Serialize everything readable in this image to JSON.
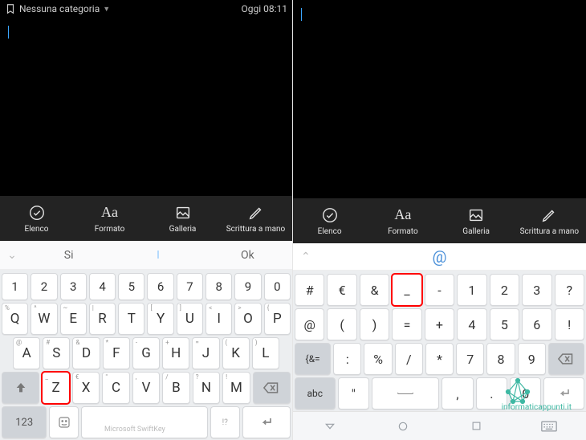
{
  "left": {
    "status": {
      "category_label": "Nessuna categoria",
      "time": "Oggi 08:11"
    },
    "toolbar": {
      "elenco": "Elenco",
      "formato": "Formato",
      "galleria": "Galleria",
      "scrittura": "Scrittura a mano"
    },
    "suggestions": {
      "left": "Si",
      "center": "I",
      "right": "Ok"
    },
    "keys": {
      "row_num": [
        "1",
        "2",
        "3",
        "4",
        "5",
        "6",
        "7",
        "8",
        "9",
        "0"
      ],
      "row_q": [
        "Q",
        "W",
        "E",
        "R",
        "T",
        "Y",
        "U",
        "I",
        "O",
        "P"
      ],
      "row_q_hints": [
        "%",
        "^",
        "~",
        "|",
        "",
        "[",
        "]",
        "<",
        ">",
        "{"
      ],
      "row_a": [
        "A",
        "S",
        "D",
        "F",
        "G",
        "H",
        "J",
        "K",
        "L"
      ],
      "row_a_hints": [
        "@",
        "#",
        "&",
        "*",
        "-",
        "+",
        "=",
        "(",
        ")"
      ],
      "row_z": [
        "Z",
        "X",
        "C",
        "V",
        "B",
        "N",
        "M"
      ],
      "row_z_hints": [
        "_",
        "€",
        "\"",
        ",",
        "/",
        "?",
        "!"
      ],
      "mode_123": "123",
      "highlighted_key": "Z"
    },
    "footer_brand": "Microsoft SwiftKey"
  },
  "right": {
    "toolbar": {
      "elenco": "Elenco",
      "formato": "Formato",
      "galleria": "Galleria",
      "scrittura": "Scrittura a mano"
    },
    "at_symbol": "@",
    "keys": {
      "row1": [
        "#",
        "€",
        "&",
        "_",
        "-",
        "1",
        "2",
        "3",
        "?"
      ],
      "row2": [
        "@",
        "(",
        ")",
        "=",
        "+",
        "4",
        "5",
        "6",
        "!"
      ],
      "row3_mode": "{&=",
      "row3": [
        ":",
        "%",
        "/",
        "*",
        "7",
        "8",
        "9"
      ],
      "row4_abc": "abc",
      "row4": [
        "\"",
        "␣",
        ",",
        ".",
        "0"
      ],
      "highlighted_key": "_"
    },
    "watermark": "informaticappunti.it"
  }
}
